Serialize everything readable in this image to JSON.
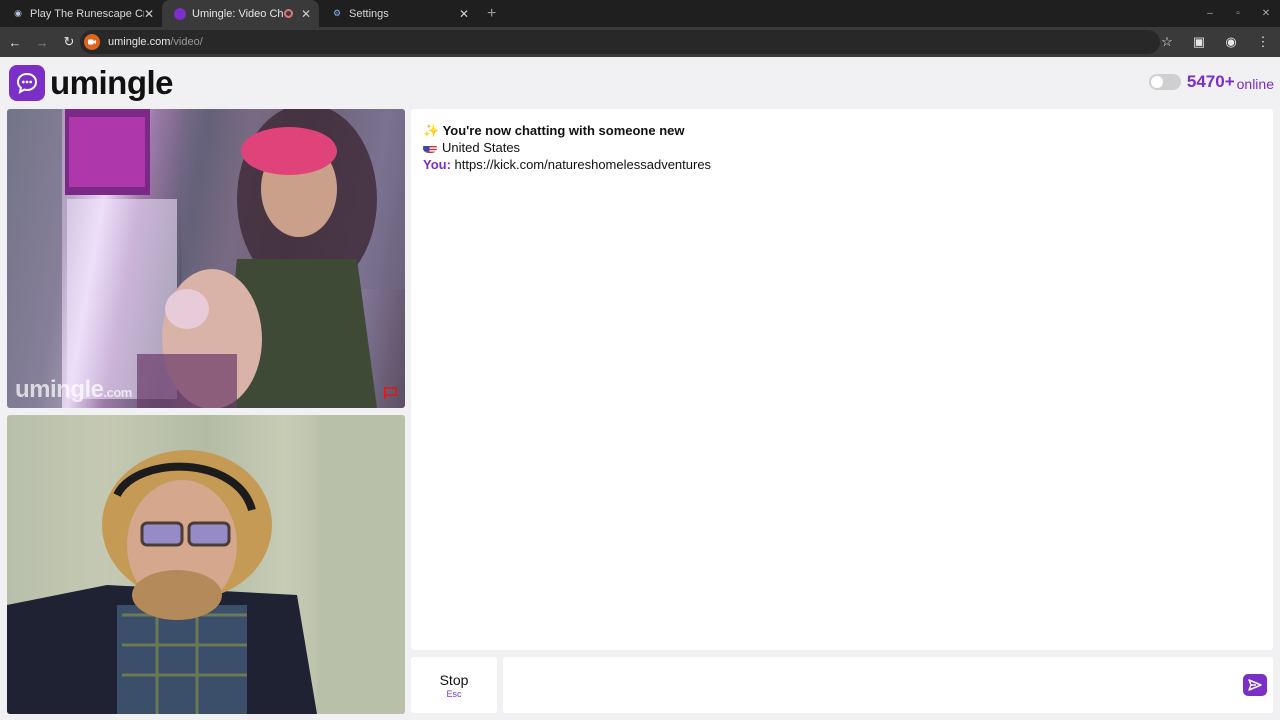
{
  "browser": {
    "tabs": [
      {
        "title": "Play The Runescape Cra",
        "favicon": "runescape-icon"
      },
      {
        "title": "Umingle: Video Chat",
        "favicon": "umingle-icon",
        "recording": true
      },
      {
        "title": "Settings",
        "favicon": "gear-icon"
      }
    ],
    "url_host": "umingle.com",
    "url_path": "/video/"
  },
  "header": {
    "logo_text": "umingle",
    "online_count": "5470+",
    "online_label": "online"
  },
  "videos": {
    "watermark_main": "umingle",
    "watermark_domain": ".com"
  },
  "chat": {
    "intro_emoji": "✨",
    "intro": "You're now chatting with someone new",
    "country": "United States",
    "you_label": "You:",
    "you_message": "https://kick.com/natureshomelessadventures"
  },
  "controls": {
    "stop_label": "Stop",
    "stop_hint": "Esc",
    "message_placeholder": ""
  },
  "colors": {
    "brand": "#7b2fc6"
  }
}
